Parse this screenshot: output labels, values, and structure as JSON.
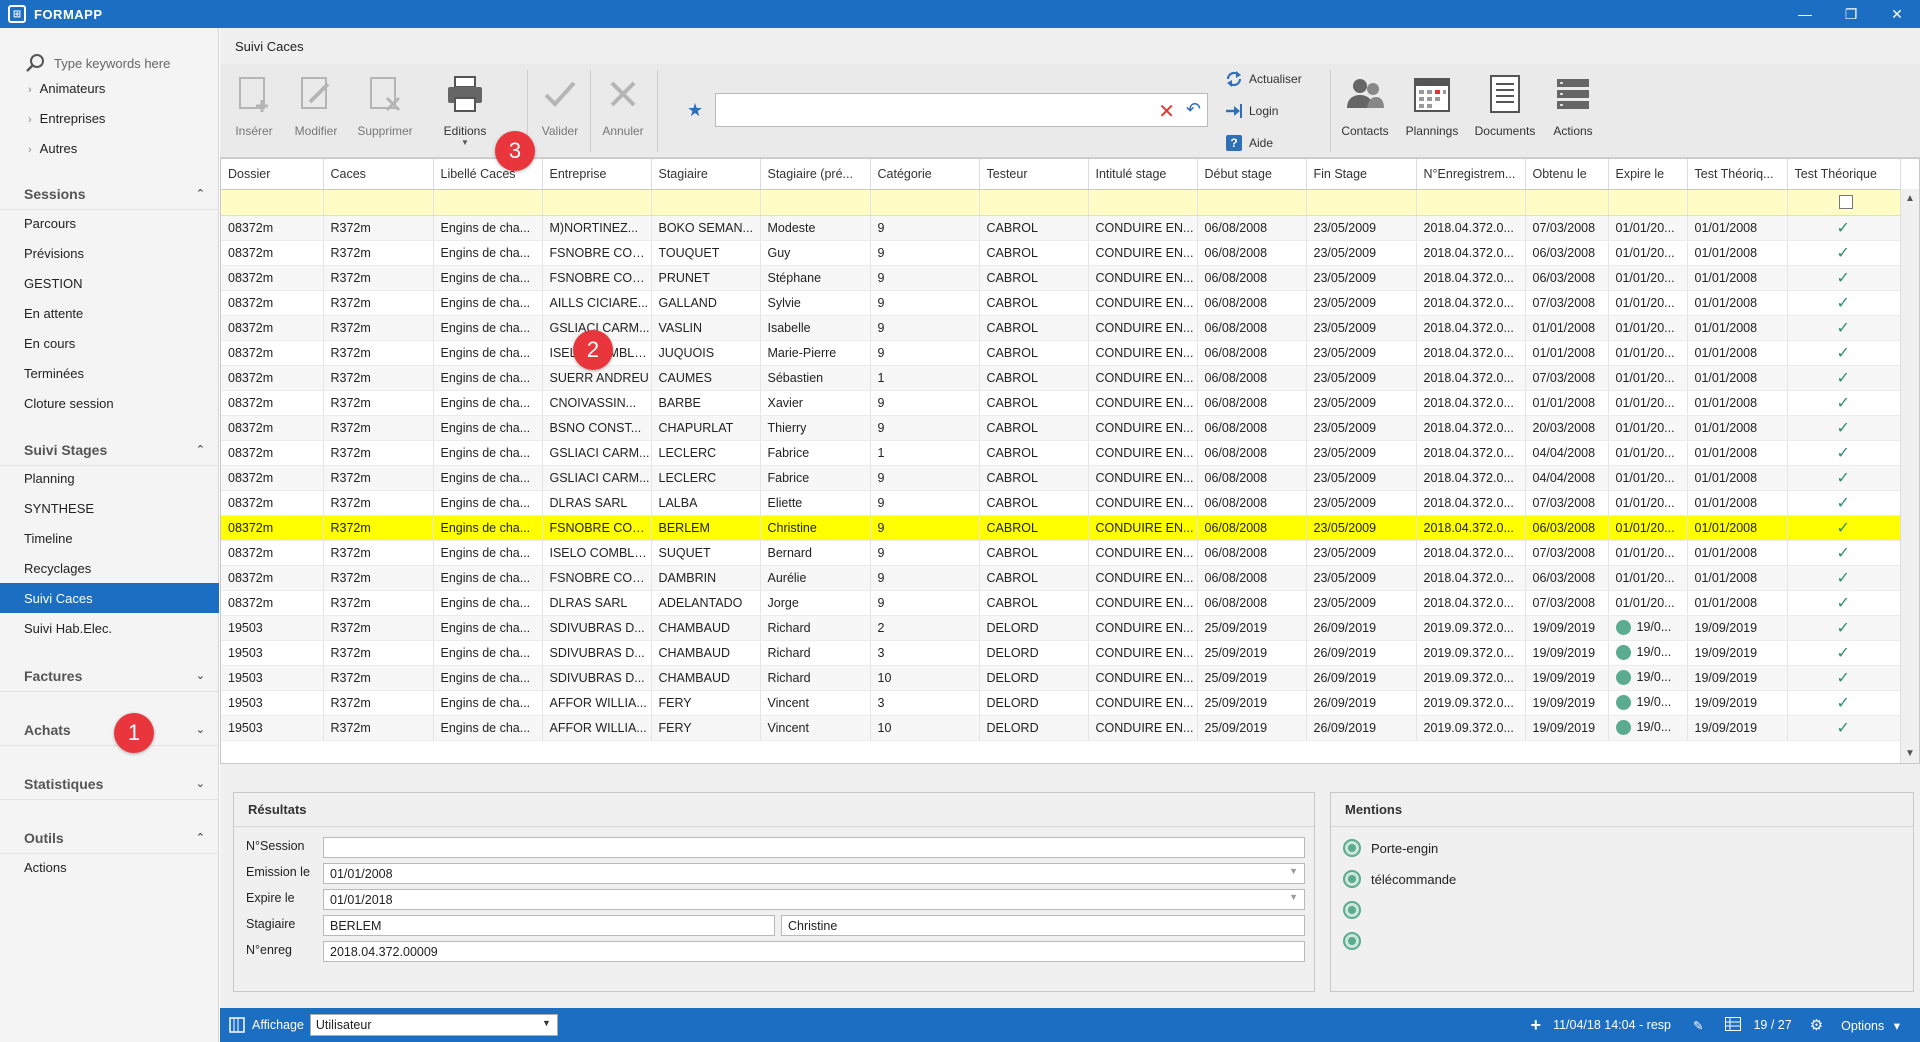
{
  "app": {
    "name": "FORMAPP",
    "window_buttons": [
      "—",
      "❐",
      "✕"
    ]
  },
  "sidebar": {
    "search_placeholder": "Type keywords here",
    "top_items": [
      "Animateurs",
      "Entreprises",
      "Autres"
    ],
    "sessions": {
      "label": "Sessions",
      "items": [
        "Parcours",
        "Prévisions",
        "GESTION",
        "En attente",
        "En cours",
        "Terminées",
        "Cloture session"
      ]
    },
    "suivi_stages": {
      "label": "Suivi Stages",
      "items": [
        "Planning",
        "SYNTHESE",
        "Timeline",
        "Recyclages",
        "Suivi Caces",
        "Suivi Hab.Elec."
      ]
    },
    "factures": "Factures",
    "achats": "Achats",
    "statistiques": "Statistiques",
    "outils": {
      "label": "Outils",
      "items": [
        "Actions"
      ]
    }
  },
  "badges": [
    "1",
    "2",
    "3"
  ],
  "main": {
    "title": "Suivi Caces"
  },
  "ribbon": {
    "inserer": "Insérer",
    "modifier": "Modifier",
    "supprimer": "Supprimer",
    "editions": "Editions",
    "valider": "Valider",
    "annuler": "Annuler",
    "actualiser": "Actualiser",
    "login": "Login",
    "aide": "Aide",
    "contacts": "Contacts",
    "plannings": "Plannings",
    "documents": "Documents",
    "actions": "Actions",
    "search_value": ""
  },
  "grid": {
    "columns": [
      "Dossier",
      "Caces",
      "Libellé Caces",
      "Entreprise",
      "Stagiaire",
      "Stagiaire (pré...",
      "Catégorie",
      "Testeur",
      "Intitulé stage",
      "Début stage",
      "Fin Stage",
      "N°Enregistrem...",
      "Obtenu le",
      "Expire le",
      "Test Théoriq...",
      "Test Théorique"
    ],
    "selected_index": 12,
    "rows": [
      [
        "08372m",
        "R372m",
        "Engins de cha...",
        "M)NORTINEZ...",
        "BOKO SEMAN...",
        "Modeste",
        "9",
        "CABROL",
        "CONDUIRE EN...",
        "06/08/2008",
        "23/05/2009",
        "2018.04.372.0...",
        "07/03/2008",
        "01/01/20...",
        "01/01/2008"
      ],
      [
        "08372m",
        "R372m",
        "Engins de cha...",
        "FSNOBRE CON...",
        "TOUQUET",
        "Guy",
        "9",
        "CABROL",
        "CONDUIRE EN...",
        "06/08/2008",
        "23/05/2009",
        "2018.04.372.0...",
        "06/03/2008",
        "01/01/20...",
        "01/01/2008"
      ],
      [
        "08372m",
        "R372m",
        "Engins de cha...",
        "FSNOBRE CON...",
        "PRUNET",
        "Stéphane",
        "9",
        "CABROL",
        "CONDUIRE EN...",
        "06/08/2008",
        "23/05/2009",
        "2018.04.372.0...",
        "06/03/2008",
        "01/01/20...",
        "01/01/2008"
      ],
      [
        "08372m",
        "R372m",
        "Engins de cha...",
        "AILLS CICIARE...",
        "GALLAND",
        "Sylvie",
        "9",
        "CABROL",
        "CONDUIRE EN...",
        "06/08/2008",
        "23/05/2009",
        "2018.04.372.0...",
        "07/03/2008",
        "01/01/20...",
        "01/01/2008"
      ],
      [
        "08372m",
        "R372m",
        "Engins de cha...",
        "GSLIACI CARM...",
        "VASLIN",
        "Isabelle",
        "9",
        "CABROL",
        "CONDUIRE EN...",
        "06/08/2008",
        "23/05/2009",
        "2018.04.372.0...",
        "01/01/2008",
        "01/01/20...",
        "01/01/2008"
      ],
      [
        "08372m",
        "R372m",
        "Engins de cha...",
        "ISELO COMBLES",
        "JUQUOIS",
        "Marie-Pierre",
        "9",
        "CABROL",
        "CONDUIRE EN...",
        "06/08/2008",
        "23/05/2009",
        "2018.04.372.0...",
        "01/01/2008",
        "01/01/20...",
        "01/01/2008"
      ],
      [
        "08372m",
        "R372m",
        "Engins de cha...",
        "SUERR ANDREU",
        "CAUMES",
        "Sébastien",
        "1",
        "CABROL",
        "CONDUIRE EN...",
        "06/08/2008",
        "23/05/2009",
        "2018.04.372.0...",
        "07/03/2008",
        "01/01/20...",
        "01/01/2008"
      ],
      [
        "08372m",
        "R372m",
        "Engins de cha...",
        "CNOIVASSIN...",
        "BARBE",
        "Xavier",
        "9",
        "CABROL",
        "CONDUIRE EN...",
        "06/08/2008",
        "23/05/2009",
        "2018.04.372.0...",
        "01/01/2008",
        "01/01/20...",
        "01/01/2008"
      ],
      [
        "08372m",
        "R372m",
        "Engins de cha...",
        "BSNO CONST...",
        "CHAPURLAT",
        "Thierry",
        "9",
        "CABROL",
        "CONDUIRE EN...",
        "06/08/2008",
        "23/05/2009",
        "2018.04.372.0...",
        "20/03/2008",
        "01/01/20...",
        "01/01/2008"
      ],
      [
        "08372m",
        "R372m",
        "Engins de cha...",
        "GSLIACI CARM...",
        "LECLERC",
        "Fabrice",
        "1",
        "CABROL",
        "CONDUIRE EN...",
        "06/08/2008",
        "23/05/2009",
        "2018.04.372.0...",
        "04/04/2008",
        "01/01/20...",
        "01/01/2008"
      ],
      [
        "08372m",
        "R372m",
        "Engins de cha...",
        "GSLIACI CARM...",
        "LECLERC",
        "Fabrice",
        "9",
        "CABROL",
        "CONDUIRE EN...",
        "06/08/2008",
        "23/05/2009",
        "2018.04.372.0...",
        "04/04/2008",
        "01/01/20...",
        "01/01/2008"
      ],
      [
        "08372m",
        "R372m",
        "Engins de cha...",
        "DLRAS SARL",
        "LALBA",
        "Eliette",
        "9",
        "CABROL",
        "CONDUIRE EN...",
        "06/08/2008",
        "23/05/2009",
        "2018.04.372.0...",
        "07/03/2008",
        "01/01/20...",
        "01/01/2008"
      ],
      [
        "08372m",
        "R372m",
        "Engins de cha...",
        "FSNOBRE CON...",
        "BERLEM",
        "Christine",
        "9",
        "CABROL",
        "CONDUIRE EN...",
        "06/08/2008",
        "23/05/2009",
        "2018.04.372.0...",
        "06/03/2008",
        "01/01/20...",
        "01/01/2008"
      ],
      [
        "08372m",
        "R372m",
        "Engins de cha...",
        "ISELO COMBLES",
        "SUQUET",
        "Bernard",
        "9",
        "CABROL",
        "CONDUIRE EN...",
        "06/08/2008",
        "23/05/2009",
        "2018.04.372.0...",
        "07/03/2008",
        "01/01/20...",
        "01/01/2008"
      ],
      [
        "08372m",
        "R372m",
        "Engins de cha...",
        "FSNOBRE CON...",
        "DAMBRIN",
        "Aurélie",
        "9",
        "CABROL",
        "CONDUIRE EN...",
        "06/08/2008",
        "23/05/2009",
        "2018.04.372.0...",
        "06/03/2008",
        "01/01/20...",
        "01/01/2008"
      ],
      [
        "08372m",
        "R372m",
        "Engins de cha...",
        "DLRAS SARL",
        "ADELANTADO",
        "Jorge",
        "9",
        "CABROL",
        "CONDUIRE EN...",
        "06/08/2008",
        "23/05/2009",
        "2018.04.372.0...",
        "07/03/2008",
        "01/01/20...",
        "01/01/2008"
      ],
      [
        "19503",
        "R372m",
        "Engins de cha...",
        "SDIVUBRAS D...",
        "CHAMBAUD",
        "Richard",
        "2",
        "DELORD",
        "CONDUIRE EN...",
        "25/09/2019",
        "26/09/2019",
        "2019.09.372.0...",
        "19/09/2019",
        "19/0...",
        "19/09/2019"
      ],
      [
        "19503",
        "R372m",
        "Engins de cha...",
        "SDIVUBRAS D...",
        "CHAMBAUD",
        "Richard",
        "3",
        "DELORD",
        "CONDUIRE EN...",
        "25/09/2019",
        "26/09/2019",
        "2019.09.372.0...",
        "19/09/2019",
        "19/0...",
        "19/09/2019"
      ],
      [
        "19503",
        "R372m",
        "Engins de cha...",
        "SDIVUBRAS D...",
        "CHAMBAUD",
        "Richard",
        "10",
        "DELORD",
        "CONDUIRE EN...",
        "25/09/2019",
        "26/09/2019",
        "2019.09.372.0...",
        "19/09/2019",
        "19/0...",
        "19/09/2019"
      ],
      [
        "19503",
        "R372m",
        "Engins de cha...",
        "AFFOR WILLIA...",
        "FERY",
        "Vincent",
        "3",
        "DELORD",
        "CONDUIRE EN...",
        "25/09/2019",
        "26/09/2019",
        "2019.09.372.0...",
        "19/09/2019",
        "19/0...",
        "19/09/2019"
      ],
      [
        "19503",
        "R372m",
        "Engins de cha...",
        "AFFOR WILLIA...",
        "FERY",
        "Vincent",
        "10",
        "DELORD",
        "CONDUIRE EN...",
        "25/09/2019",
        "26/09/2019",
        "2019.09.372.0...",
        "19/09/2019",
        "19/0...",
        "19/09/2019"
      ]
    ],
    "expire_dot_from_row": 16
  },
  "resultats": {
    "title": "Résultats",
    "nsession_label": "N°Session",
    "nsession_value": "",
    "emission_label": "Emission le",
    "emission_value": "01/01/2008",
    "expire_label": "Expire le",
    "expire_value": "01/01/2018",
    "stagiaire_label": "Stagiaire",
    "stagiaire_nom": "BERLEM",
    "stagiaire_prenom": "Christine",
    "nenreg_label": "N°enreg",
    "nenreg_value": "2018.04.372.00009"
  },
  "mentions": {
    "title": "Mentions",
    "items": [
      "Porte-engin",
      "télécommande",
      "",
      ""
    ]
  },
  "statusbar": {
    "affichage_label": "Affichage",
    "affichage_value": "Utilisateur",
    "timestamp": "11/04/18 14:04 - resp",
    "pager": "19 / 27",
    "options": "Options"
  },
  "colors": {
    "accent": "#1b6ec2",
    "selected_row": "#ffff00",
    "filter_row": "#fffdc5",
    "badge": "#e8363c",
    "check": "#2f8f6e"
  }
}
